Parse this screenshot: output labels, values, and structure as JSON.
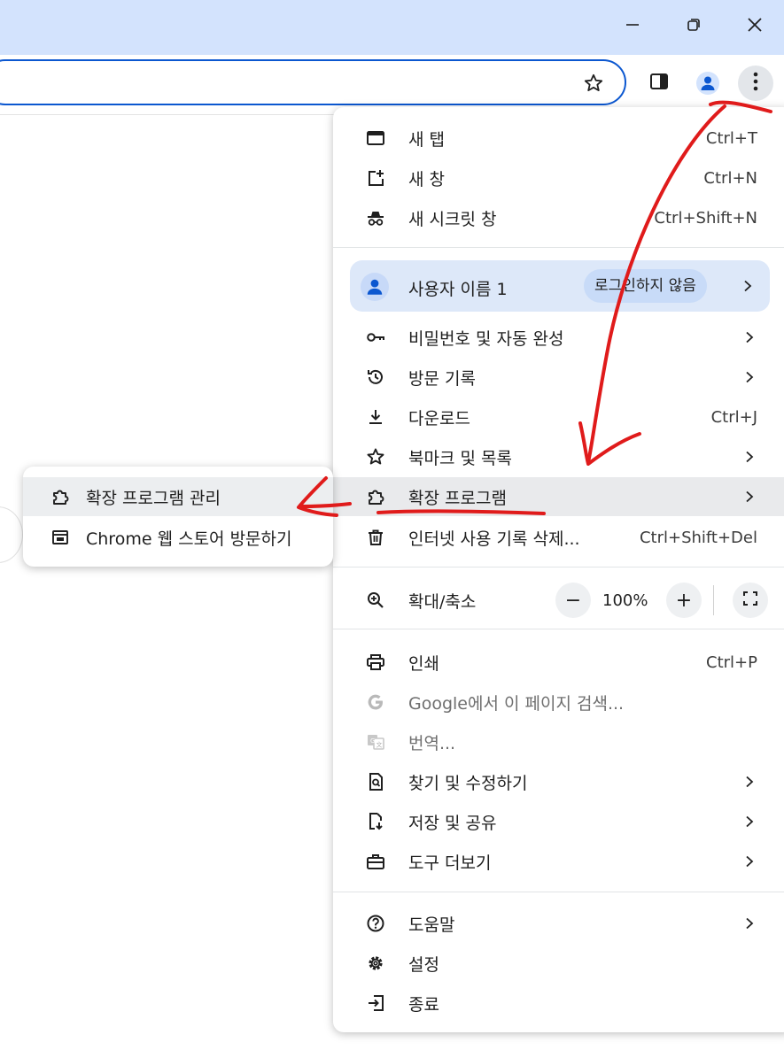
{
  "window_controls": {
    "minimize_icon": "minimize-icon",
    "restore_icon": "restore-icon",
    "close_icon": "close-icon"
  },
  "toolbar": {
    "bookmark_icon": "star-icon",
    "side_panel_icon": "side-panel-icon",
    "profile_icon": "profile-icon",
    "menu_icon": "kebab-menu-icon"
  },
  "menu": {
    "new_tab": {
      "label": "새 탭",
      "shortcut": "Ctrl+T"
    },
    "new_window": {
      "label": "새 창",
      "shortcut": "Ctrl+N"
    },
    "incognito": {
      "label": "새 시크릿 창",
      "shortcut": "Ctrl+Shift+N"
    },
    "profile": {
      "name": "사용자 이름 1",
      "status": "로그인하지 않음"
    },
    "passwords": {
      "label": "비밀번호 및 자동 완성"
    },
    "history": {
      "label": "방문 기록"
    },
    "downloads": {
      "label": "다운로드",
      "shortcut": "Ctrl+J"
    },
    "bookmarks": {
      "label": "북마크 및 목록"
    },
    "extensions": {
      "label": "확장 프로그램"
    },
    "clear_data": {
      "label": "인터넷 사용 기록 삭제...",
      "shortcut": "Ctrl+Shift+Del"
    },
    "zoom": {
      "label": "확대/축소",
      "minus": "−",
      "value": "100%",
      "plus": "+"
    },
    "print": {
      "label": "인쇄",
      "shortcut": "Ctrl+P"
    },
    "search_page": {
      "label": "Google에서 이 페이지 검색..."
    },
    "translate": {
      "label": "번역..."
    },
    "find_edit": {
      "label": "찾기 및 수정하기"
    },
    "save_share": {
      "label": "저장 및 공유"
    },
    "more_tools": {
      "label": "도구 더보기"
    },
    "help": {
      "label": "도움말"
    },
    "settings": {
      "label": "설정"
    },
    "exit": {
      "label": "종료"
    }
  },
  "submenu": {
    "manage_extensions": {
      "label": "확장 프로그램 관리"
    },
    "web_store": {
      "label": "Chrome 웹 스토어 방문하기"
    }
  },
  "colors": {
    "titlebar": "#d3e3fd",
    "accent": "#0b57d0",
    "annotation": "#e01b1b",
    "highlight": "#e9eaec"
  }
}
